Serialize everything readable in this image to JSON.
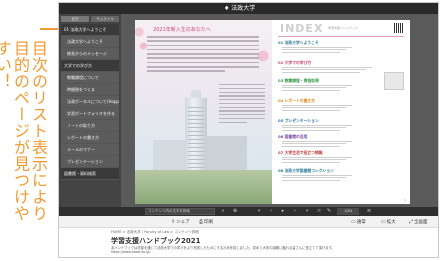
{
  "caption": {
    "columns": [
      "目次のリスト表示により",
      "目的のページが見つけや",
      "すい！"
    ],
    "color": "#f39a32"
  },
  "viewer": {
    "logo": "♦ 法政大学",
    "toc": {
      "tabs": [
        "目次",
        "サムネイル"
      ],
      "items": [
        {
          "label": "01 法政大学へようこそ",
          "active": true
        },
        {
          "label": "法政大学へようこそ",
          "sub": true
        },
        {
          "label": "総長からのメッセージ",
          "sub": true
        },
        {
          "label": "大学での学び方",
          "active": true
        },
        {
          "label": "教職課程について",
          "sub": true
        },
        {
          "label": "時間割をつくる",
          "sub": true
        },
        {
          "label": "法政ポータルについて(Hoppii)",
          "sub": true
        },
        {
          "label": "学習ポートフォリオを作る",
          "sub": true
        },
        {
          "label": "ノートの取り方",
          "sub": true
        },
        {
          "label": "レポートの書き方",
          "sub": true
        },
        {
          "label": "メールのマナー",
          "sub": true
        },
        {
          "label": "プレゼンテーション",
          "sub": true
        },
        {
          "label": "図書館・資料検索",
          "active": true
        }
      ]
    },
    "left_page": {
      "title": "2021年新入生のあなたへ"
    },
    "right_page": {
      "index_title": "INDEX",
      "index_sub": "学習支援ハンドブック",
      "sections": [
        {
          "head": "01 法政大学へようこそ",
          "color": "#2e7d9a"
        },
        {
          "head": "02 大学での学び方",
          "color": "#d2477a"
        },
        {
          "head": "03 教職課程・資格取得",
          "color": "#3a9a4a"
        },
        {
          "head": "04 レポートの書き方",
          "color": "#e08a1e"
        },
        {
          "head": "05 プレゼンテーション",
          "color": "#2a6fb5"
        },
        {
          "head": "06 図書館の活用",
          "color": "#7a4aa0"
        },
        {
          "head": "07 大学生活で役立つ情報",
          "color": "#c23b3b"
        },
        {
          "head": "08 法政大学図書館コレクション",
          "color": "#2e7d9a"
        }
      ],
      "page_number": "1"
    },
    "toolbar": {
      "search_placeholder": "コンテンツ内の文字を検索",
      "page_indicator": "1/84"
    },
    "subbar": {
      "share": "シェア",
      "print": "印刷",
      "view_mode": "通常",
      "enlarge": "拡大",
      "fullscreen": "全画面"
    },
    "info": {
      "breadcrumb": "HOME > 法政大学 / Faculty of Law > コンテンツ詳細",
      "doc_title": "学習支援ハンドブック2021",
      "description": "本ハンドブックは学部を通じて法政大学での学びをより充実したものにするため作成しました。初めて大学の講義に触れる皆さんに役立てて頂けます。\nhttps://www.hosei.ac.jp/"
    }
  }
}
